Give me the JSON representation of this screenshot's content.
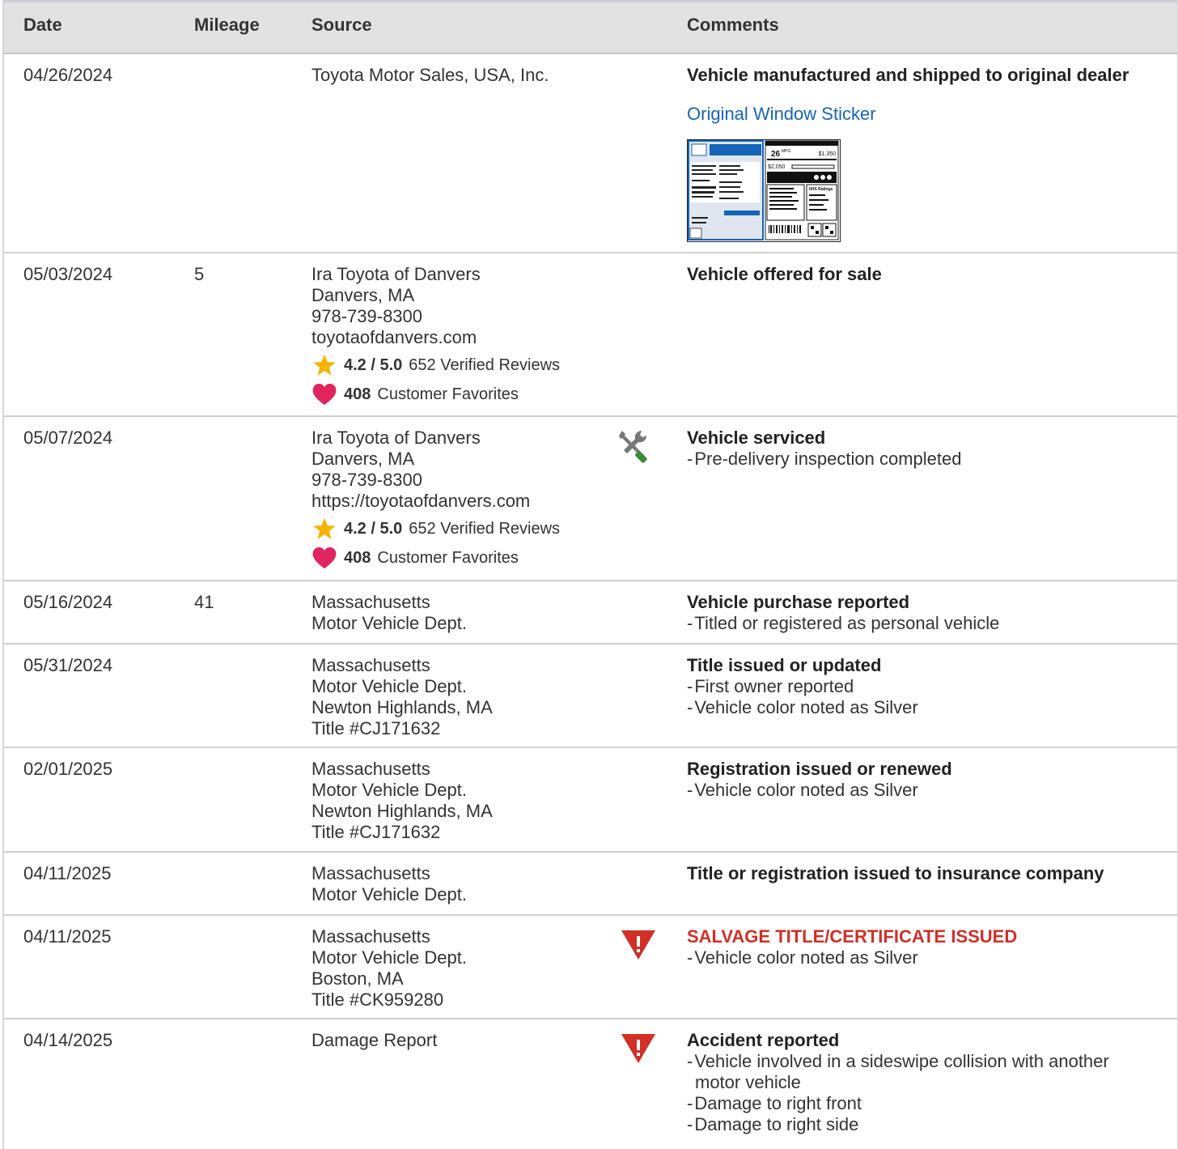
{
  "headers": {
    "date": "Date",
    "mileage": "Mileage",
    "source": "Source",
    "comments": "Comments"
  },
  "rows": [
    {
      "date": "04/26/2024",
      "mileage": "",
      "source": [
        "Toyota Motor Sales, USA, Inc."
      ],
      "title": "Vehicle manufactured and shipped to original dealer",
      "link": "Original Window Sticker",
      "sticker": {
        "mpg": "26",
        "mpg_unit": "MPG",
        "save": "$1,350",
        "cost": "$2,050",
        "ratings": "IIHS Ratings"
      }
    },
    {
      "date": "05/03/2024",
      "mileage": "5",
      "source": [
        "Ira Toyota of Danvers",
        "Danvers, MA",
        "978-739-8300",
        "toyotaofdanvers.com"
      ],
      "rating_score": "4.2 / 5.0",
      "rating_text": "652 Verified Reviews",
      "fav_count": "408",
      "fav_text": "Customer Favorites",
      "title": "Vehicle offered for sale"
    },
    {
      "date": "05/07/2024",
      "mileage": "",
      "source": [
        "Ira Toyota of Danvers",
        "Danvers, MA",
        "978-739-8300",
        "https://toyotaofdanvers.com"
      ],
      "rating_score": "4.2 / 5.0",
      "rating_text": "652 Verified Reviews",
      "fav_count": "408",
      "fav_text": "Customer Favorites",
      "icon": "service-tools-icon",
      "title": "Vehicle serviced",
      "items": [
        "Pre-delivery inspection completed"
      ]
    },
    {
      "date": "05/16/2024",
      "mileage": "41",
      "source": [
        "Massachusetts",
        "Motor Vehicle Dept."
      ],
      "title": "Vehicle purchase reported",
      "items": [
        "Titled or registered as personal vehicle"
      ]
    },
    {
      "date": "05/31/2024",
      "mileage": "",
      "source": [
        "Massachusetts",
        "Motor Vehicle Dept.",
        "Newton Highlands, MA",
        "Title #CJ171632"
      ],
      "title": "Title issued or updated",
      "items": [
        "First owner reported",
        "Vehicle color noted as Silver"
      ]
    },
    {
      "date": "02/01/2025",
      "mileage": "",
      "source": [
        "Massachusetts",
        "Motor Vehicle Dept.",
        "Newton Highlands, MA",
        "Title #CJ171632"
      ],
      "title": "Registration issued or renewed",
      "items": [
        "Vehicle color noted as Silver"
      ]
    },
    {
      "date": "04/11/2025",
      "mileage": "",
      "source": [
        "Massachusetts",
        "Motor Vehicle Dept."
      ],
      "title": "Title or registration issued to insurance company"
    },
    {
      "date": "04/11/2025",
      "mileage": "",
      "source": [
        "Massachusetts",
        "Motor Vehicle Dept.",
        "Boston, MA",
        "Title #CK959280"
      ],
      "icon": "alert-icon",
      "title": "SALVAGE TITLE/CERTIFICATE ISSUED",
      "alert": true,
      "items": [
        "Vehicle color noted as Silver"
      ]
    },
    {
      "date": "04/14/2025",
      "mileage": "",
      "source": [
        "Damage Report"
      ],
      "icon": "alert-icon",
      "title": "Accident reported",
      "items": [
        "Vehicle involved in a sideswipe collision with another motor vehicle",
        "Damage to right front",
        "Damage to right side"
      ]
    }
  ],
  "colors": {
    "alert": "#d22f27",
    "link": "#1565b8",
    "star": "#f5b301",
    "heart": "#e0245e",
    "tool_green": "#3a8a3a"
  }
}
